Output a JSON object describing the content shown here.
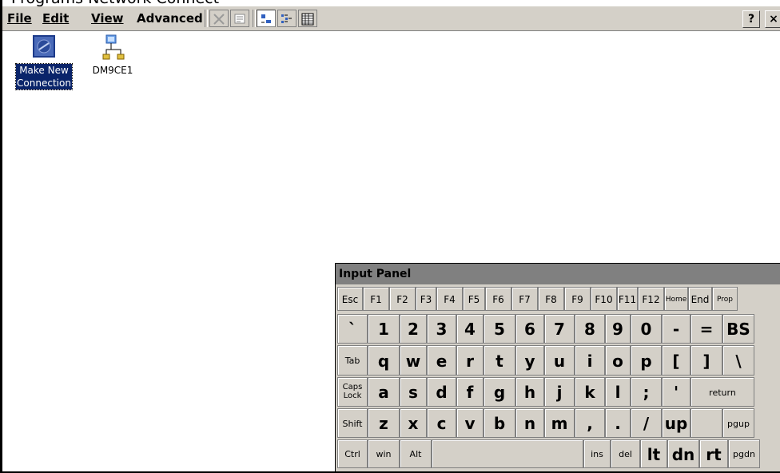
{
  "top_cutoff_text": "Programs Network Connect",
  "menubar": {
    "items": [
      "File",
      "Edit",
      "View",
      "Advanced"
    ],
    "help_label": "?",
    "close_label": "×"
  },
  "icons": [
    {
      "label_line1": "Make New",
      "label_line2": "Connection",
      "selected": true
    },
    {
      "label_line1": "DM9CE1",
      "label_line2": "",
      "selected": false
    }
  ],
  "input_panel": {
    "title": "Input Panel",
    "rows": [
      [
        "Esc",
        "F1",
        "F2",
        "F3",
        "F4",
        "F5",
        "F6",
        "F7",
        "F8",
        "F9",
        "F10",
        "F11",
        "F12",
        "Home",
        "End",
        "Prop"
      ],
      [
        "`",
        "1",
        "2",
        "3",
        "4",
        "5",
        "6",
        "7",
        "8",
        "9",
        "0",
        "-",
        "=",
        "BS"
      ],
      [
        "Tab",
        "q",
        "w",
        "e",
        "r",
        "t",
        "y",
        "u",
        "i",
        "o",
        "p",
        "[",
        "]",
        "\\"
      ],
      [
        "Caps\nLock",
        "a",
        "s",
        "d",
        "f",
        "g",
        "h",
        "j",
        "k",
        "l",
        ";",
        "'",
        "return"
      ],
      [
        "Shift",
        "z",
        "x",
        "c",
        "v",
        "b",
        "n",
        "m",
        ",",
        ".",
        "/",
        "up",
        "",
        "pgup"
      ],
      [
        "Ctrl",
        "win",
        "Alt",
        "",
        "ins",
        "del",
        "lt",
        "dn",
        "rt",
        "pgdn"
      ]
    ]
  }
}
